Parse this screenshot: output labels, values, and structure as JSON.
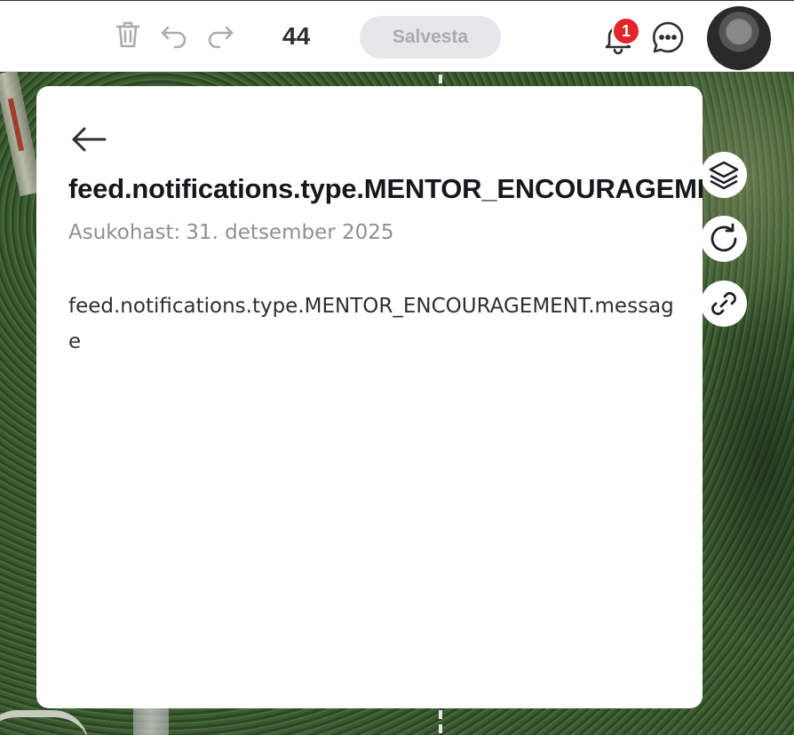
{
  "toolbar": {
    "count": "44",
    "save_label": "Salvesta",
    "notification_count": "1",
    "icons": [
      "trash-icon",
      "undo-icon",
      "redo-icon",
      "bell-icon",
      "chat-icon"
    ]
  },
  "map_controls": {
    "icons": [
      "layers-icon",
      "refresh-icon",
      "link-icon"
    ]
  },
  "panel": {
    "title": "feed.notifications.type.MENTOR_ENCOURAGEMENT",
    "location_label": "Asukohast:",
    "date": "31. detsember 2025",
    "message": "feed.notifications.type.MENTOR_ENCOURAGEMENT.message"
  },
  "colors": {
    "badge": "#e3262c",
    "save_bg": "#e6e7ea",
    "save_text": "#a7aaaf",
    "panel_bg": "#ffffff"
  }
}
